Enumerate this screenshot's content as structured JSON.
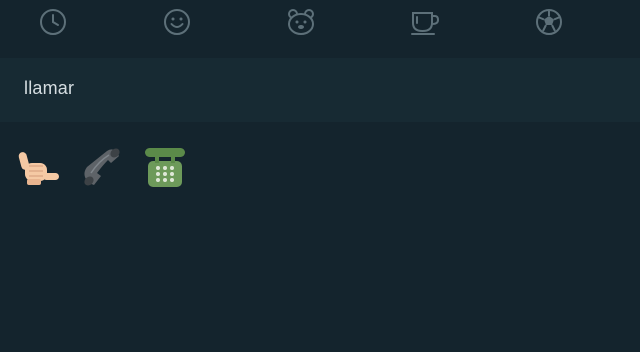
{
  "tabs": [
    {
      "icon": "clock-icon"
    },
    {
      "icon": "smiley-icon"
    },
    {
      "icon": "bear-icon"
    },
    {
      "icon": "cup-icon"
    },
    {
      "icon": "soccer-ball-icon"
    }
  ],
  "search": {
    "query": "llamar"
  },
  "results": [
    {
      "icon": "call-me-hand-emoji"
    },
    {
      "icon": "telephone-receiver-emoji"
    },
    {
      "icon": "telephone-emoji"
    }
  ],
  "colors": {
    "background": "#14242d",
    "search_bg": "#172a33",
    "icon_stroke": "#5d7079",
    "text": "#d5dde1"
  }
}
